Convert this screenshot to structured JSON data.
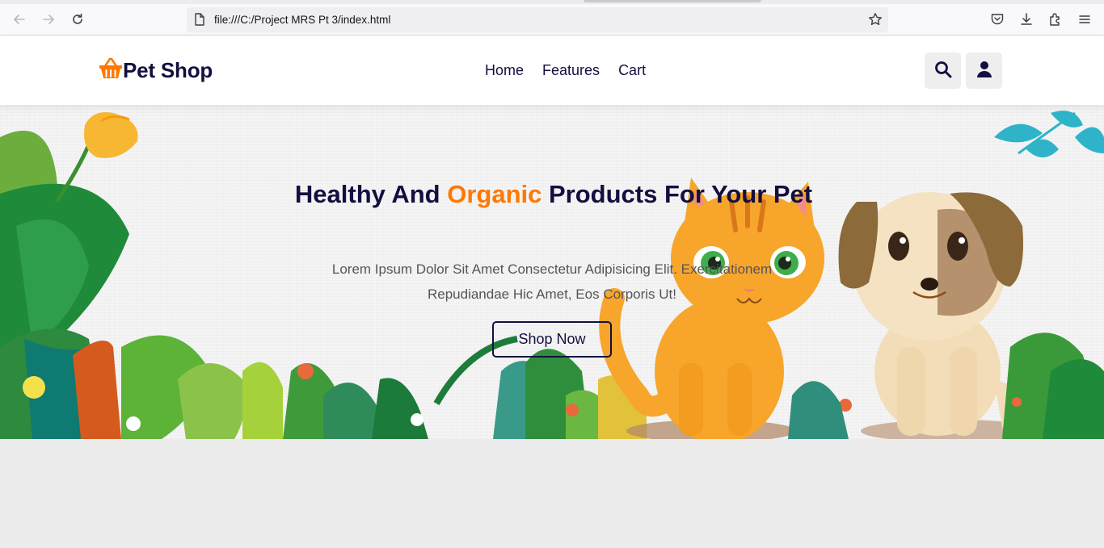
{
  "browser": {
    "url": "file:///C:/Project MRS Pt 3/index.html",
    "icons": [
      "back-icon",
      "forward-icon",
      "reload-icon",
      "page-icon",
      "bookmark-star-icon",
      "pocket-icon",
      "download-icon",
      "extensions-icon",
      "menu-icon"
    ]
  },
  "header": {
    "logo_text": "Pet Shop",
    "logo_icon": "basket-icon",
    "nav": [
      "Home",
      "Features",
      "Cart"
    ],
    "buttons": [
      "search-icon",
      "user-icon"
    ]
  },
  "hero": {
    "title_part1": "Healthy And ",
    "title_accent": "Organic",
    "title_part2": " Products For Your Pet",
    "subtitle": "Lorem Ipsum Dolor Sit Amet Consectetur Adipisicing Elit. Exercitationem Repudiandae Hic Amet, Eos Corporis Ut!",
    "cta_label": "Shop Now"
  },
  "colors": {
    "brand_dark": "#130f40",
    "accent": "#ff7800",
    "page_bg": "#ececec"
  }
}
